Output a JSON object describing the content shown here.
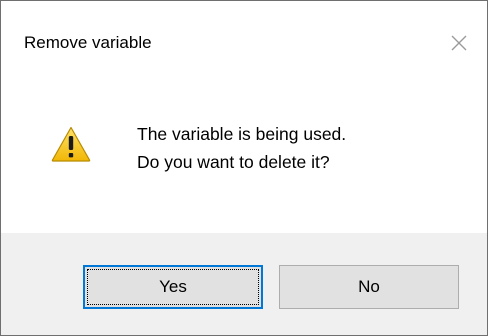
{
  "dialog": {
    "title": "Remove variable",
    "icon": "warning-icon",
    "message_lines": [
      "The variable is being used.",
      "Do you want to delete it?"
    ],
    "buttons": {
      "yes_label": "Yes",
      "no_label": "No"
    },
    "default_button": "Yes"
  },
  "colors": {
    "focus_border": "#0078d7",
    "footer_background": "#f0f0f0",
    "warning_yellow": "#f7c21c"
  }
}
